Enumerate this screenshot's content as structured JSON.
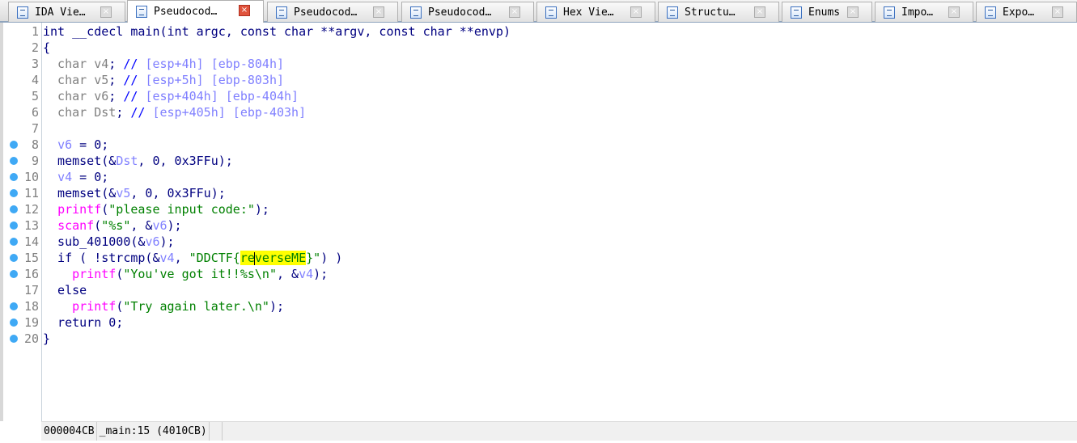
{
  "tabs": [
    {
      "label": "IDA Vie…",
      "icon": "ida-view-icon",
      "active": false
    },
    {
      "label": "Pseudocod…",
      "icon": "pseudocode-icon",
      "active": true
    },
    {
      "label": "Pseudocod…",
      "icon": "pseudocode-icon",
      "active": false
    },
    {
      "label": "Pseudocod…",
      "icon": "pseudocode-icon",
      "active": false
    },
    {
      "label": "Hex Vie…",
      "icon": "hex-view-icon",
      "active": false
    },
    {
      "label": "Structu…",
      "icon": "structures-icon",
      "active": false
    },
    {
      "label": "Enums",
      "icon": "enums-icon",
      "active": false
    },
    {
      "label": "Impo…",
      "icon": "imports-icon",
      "active": false
    },
    {
      "label": "Expo…",
      "icon": "exports-icon",
      "active": false
    }
  ],
  "close_glyph": "×",
  "code": {
    "lines": [
      {
        "n": "1",
        "bp": false,
        "tokens": [
          [
            "int __cdecl main(int argc, const char **argv, const char **envp)",
            "k"
          ]
        ]
      },
      {
        "n": "2",
        "bp": false,
        "tokens": [
          [
            "{",
            "k"
          ]
        ]
      },
      {
        "n": "3",
        "bp": false,
        "tokens": [
          [
            "  char v4",
            "g"
          ],
          [
            "; ",
            "k"
          ],
          [
            "// ",
            "cm"
          ],
          [
            "[esp+4h] [ebp-804h]",
            "cv"
          ]
        ]
      },
      {
        "n": "4",
        "bp": false,
        "tokens": [
          [
            "  char v5",
            "g"
          ],
          [
            "; ",
            "k"
          ],
          [
            "// ",
            "cm"
          ],
          [
            "[esp+5h] [ebp-803h]",
            "cv"
          ]
        ]
      },
      {
        "n": "5",
        "bp": false,
        "tokens": [
          [
            "  char v6",
            "g"
          ],
          [
            "; ",
            "k"
          ],
          [
            "// ",
            "cm"
          ],
          [
            "[esp+404h] [ebp-404h]",
            "cv"
          ]
        ]
      },
      {
        "n": "6",
        "bp": false,
        "tokens": [
          [
            "  char Dst",
            "g"
          ],
          [
            "; ",
            "k"
          ],
          [
            "// ",
            "cm"
          ],
          [
            "[esp+405h] [ebp-403h]",
            "cv"
          ]
        ]
      },
      {
        "n": "7",
        "bp": false,
        "tokens": []
      },
      {
        "n": "8",
        "bp": true,
        "tokens": [
          [
            "  ",
            "k"
          ],
          [
            "v6",
            "v"
          ],
          [
            " = 0;",
            "k"
          ]
        ]
      },
      {
        "n": "9",
        "bp": true,
        "tokens": [
          [
            "  memset(&",
            "k"
          ],
          [
            "Dst",
            "v"
          ],
          [
            ", 0, 0x3FFu);",
            "k"
          ]
        ]
      },
      {
        "n": "10",
        "bp": true,
        "tokens": [
          [
            "  ",
            "k"
          ],
          [
            "v4",
            "v"
          ],
          [
            " = 0;",
            "k"
          ]
        ]
      },
      {
        "n": "11",
        "bp": true,
        "tokens": [
          [
            "  memset(&",
            "k"
          ],
          [
            "v5",
            "v"
          ],
          [
            ", 0, 0x3FFu);",
            "k"
          ]
        ]
      },
      {
        "n": "12",
        "bp": true,
        "tokens": [
          [
            "  ",
            "k"
          ],
          [
            "printf",
            "f"
          ],
          [
            "(",
            "k"
          ],
          [
            "\"please input code:\"",
            "s"
          ],
          [
            ");",
            "k"
          ]
        ]
      },
      {
        "n": "13",
        "bp": true,
        "tokens": [
          [
            "  ",
            "k"
          ],
          [
            "scanf",
            "f"
          ],
          [
            "(",
            "k"
          ],
          [
            "\"%s\"",
            "s"
          ],
          [
            ", &",
            "k"
          ],
          [
            "v6",
            "v"
          ],
          [
            ");",
            "k"
          ]
        ]
      },
      {
        "n": "14",
        "bp": true,
        "tokens": [
          [
            "  sub_401000(&",
            "k"
          ],
          [
            "v6",
            "v"
          ],
          [
            ");",
            "k"
          ]
        ]
      },
      {
        "n": "15",
        "bp": true,
        "tokens": [
          [
            "  if ( !strcmp(&",
            "k"
          ],
          [
            "v4",
            "v"
          ],
          [
            ", ",
            "k"
          ],
          [
            "\"DDCTF{",
            "s"
          ],
          [
            "re",
            "hl"
          ],
          [
            "|",
            "cursor"
          ],
          [
            "verseME",
            "hl"
          ],
          [
            "}\"",
            "s"
          ],
          [
            ") )",
            "k"
          ]
        ]
      },
      {
        "n": "16",
        "bp": true,
        "tokens": [
          [
            "    ",
            "k"
          ],
          [
            "printf",
            "f"
          ],
          [
            "(",
            "k"
          ],
          [
            "\"You've got it!!%s\\n\"",
            "s"
          ],
          [
            ", &",
            "k"
          ],
          [
            "v4",
            "v"
          ],
          [
            ");",
            "k"
          ]
        ]
      },
      {
        "n": "17",
        "bp": false,
        "tokens": [
          [
            "  else",
            "k"
          ]
        ]
      },
      {
        "n": "18",
        "bp": true,
        "tokens": [
          [
            "    ",
            "k"
          ],
          [
            "printf",
            "f"
          ],
          [
            "(",
            "k"
          ],
          [
            "\"Try again later.\\n\"",
            "s"
          ],
          [
            ");",
            "k"
          ]
        ]
      },
      {
        "n": "19",
        "bp": true,
        "tokens": [
          [
            "  return 0;",
            "k"
          ]
        ]
      },
      {
        "n": "20",
        "bp": true,
        "tokens": [
          [
            "}",
            "k"
          ]
        ]
      }
    ]
  },
  "status": {
    "offset": "000004CB",
    "location": "_main:15 (4010CB)"
  },
  "colors": {
    "keyword": "#000080",
    "local_decl": "#808080",
    "variable": "#8080ff",
    "function": "#ff00ff",
    "string": "#008000",
    "highlight": "#ffff00",
    "breakpoint": "#3fa9f5"
  }
}
